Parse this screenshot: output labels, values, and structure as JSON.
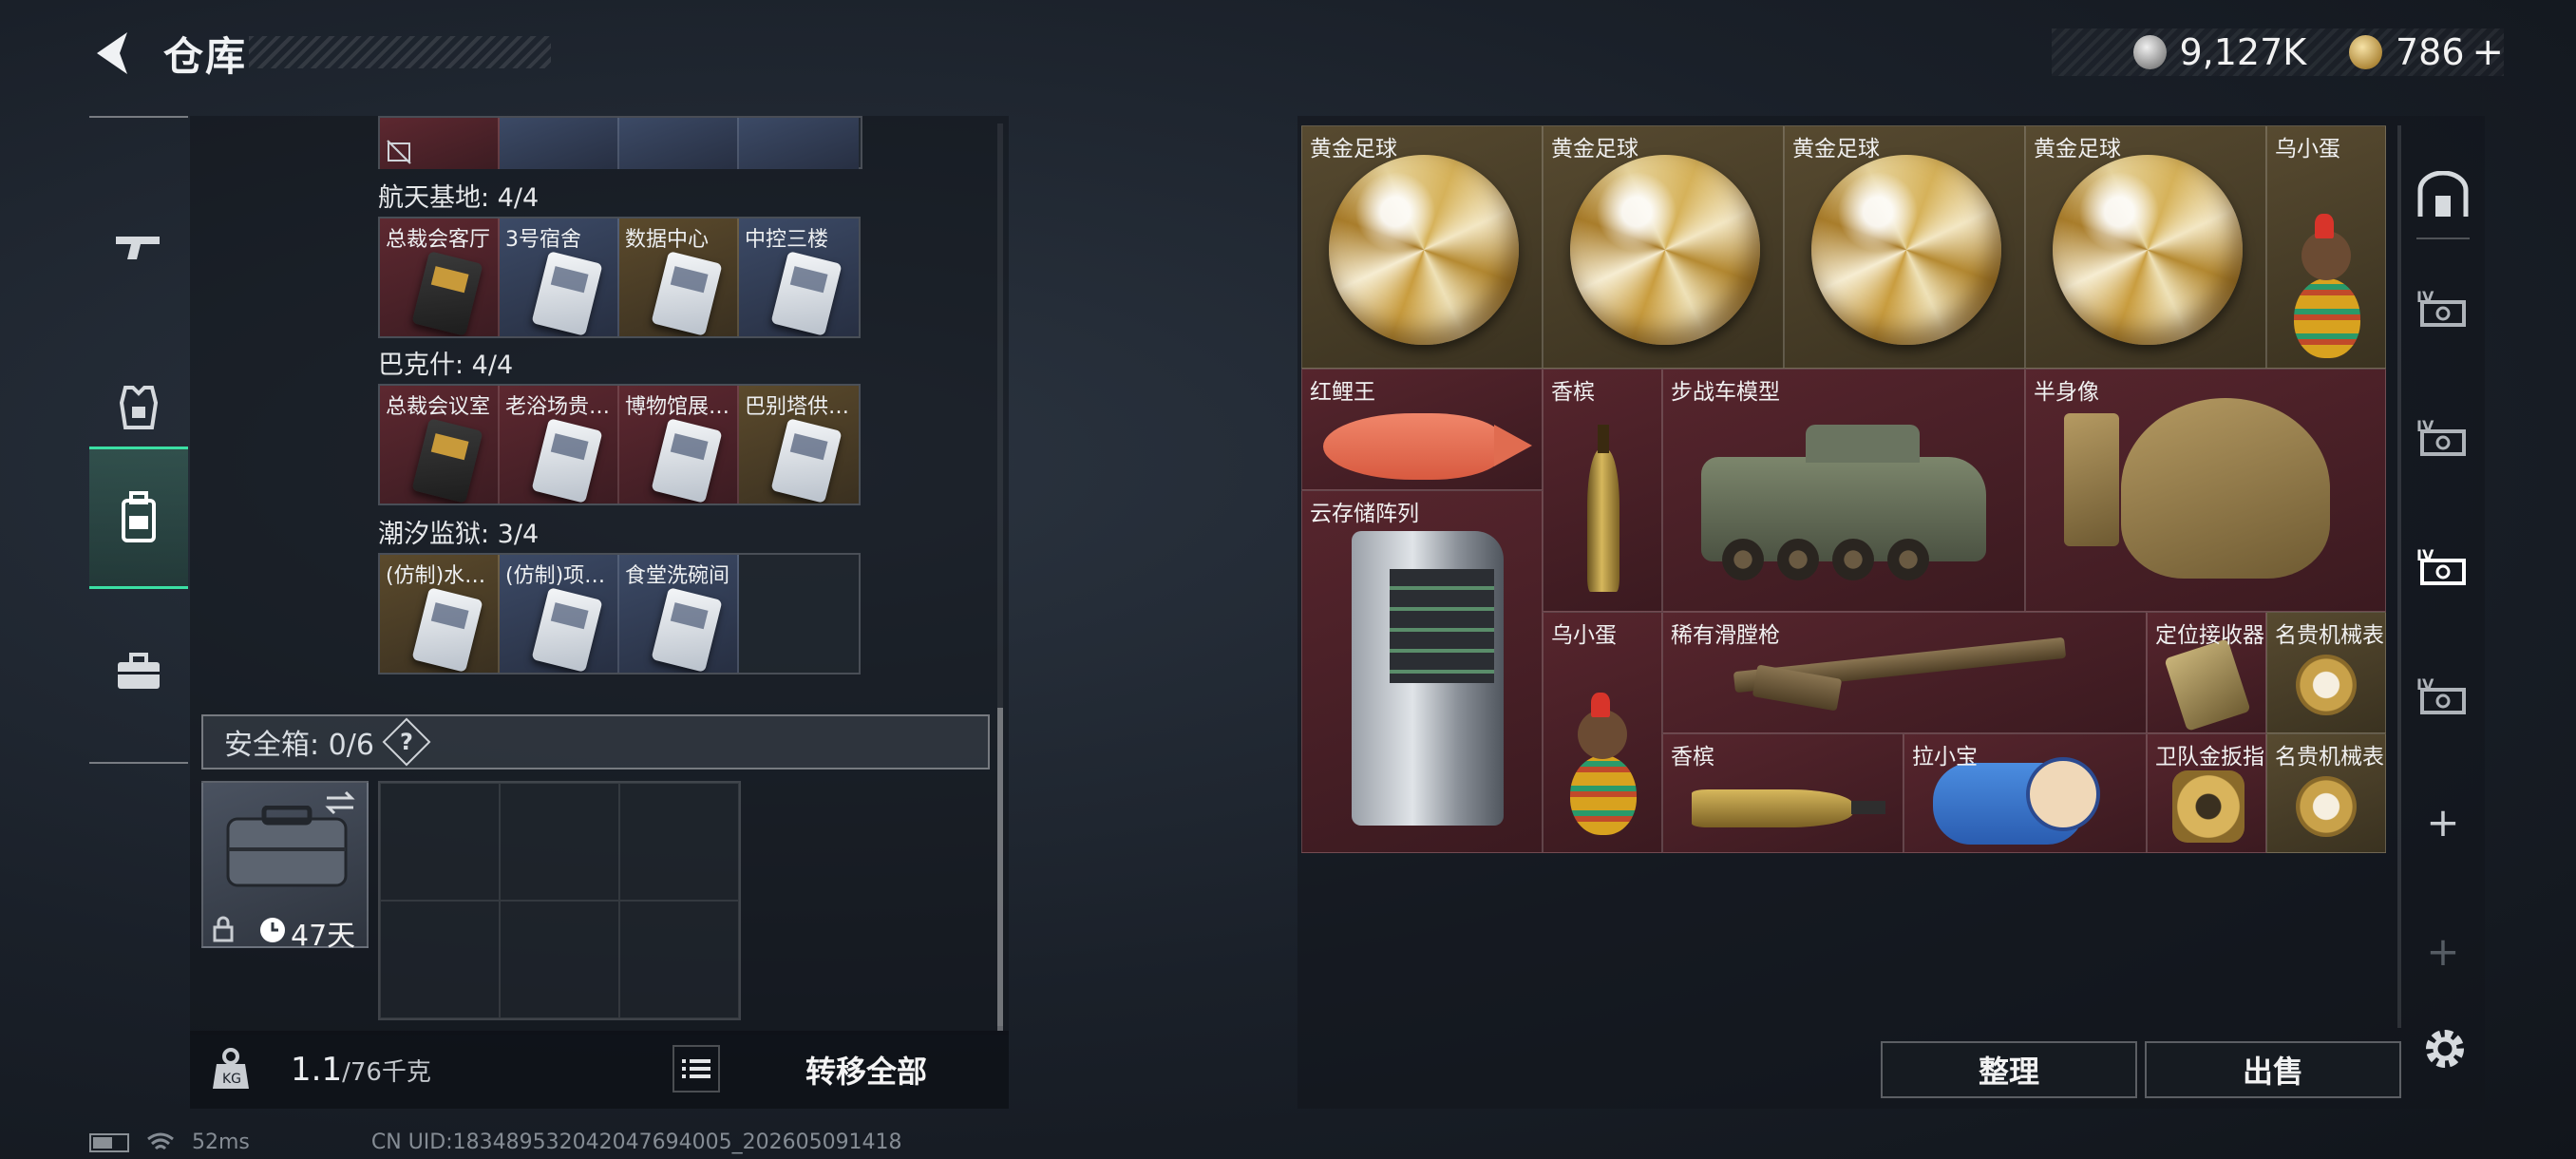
{
  "header": {
    "title": "仓库",
    "currency": [
      {
        "icon": "silver-coin-icon",
        "value": "9,127K"
      },
      {
        "icon": "gold-coin-icon",
        "value": "786",
        "suffix": "+"
      }
    ]
  },
  "left_nav": {
    "items": [
      {
        "icon": "gun-icon",
        "active": false
      },
      {
        "icon": "armor-icon",
        "active": false
      },
      {
        "icon": "backpack-icon",
        "active": true
      },
      {
        "icon": "briefcase-icon",
        "active": false
      }
    ]
  },
  "keycard_groups": [
    {
      "label": "航天基地: 4/4",
      "cards": [
        {
          "name": "总裁会客厅",
          "color": "red"
        },
        {
          "name": "3号宿舍",
          "color": "blue"
        },
        {
          "name": "数据中心",
          "color": "gold"
        },
        {
          "name": "中控三楼",
          "color": "blue"
        }
      ]
    },
    {
      "label": "巴克什: 4/4",
      "cards": [
        {
          "name": "总裁会议室",
          "color": "red"
        },
        {
          "name": "老浴场贵…",
          "color": "red"
        },
        {
          "name": "博物馆展…",
          "color": "red"
        },
        {
          "name": "巴别塔供…",
          "color": "gold"
        }
      ]
    },
    {
      "label": "潮汐监狱: 3/4",
      "cards": [
        {
          "name": "(仿制)水…",
          "color": "gold"
        },
        {
          "name": "(仿制)项…",
          "color": "blue"
        },
        {
          "name": "食堂洗碗间",
          "color": "blue"
        },
        {
          "name": "",
          "color": "empty"
        }
      ]
    }
  ],
  "safe_box": {
    "label": "安全箱: 0/6",
    "help": "?",
    "duration": "47天"
  },
  "weight": {
    "current": "1.1",
    "max": "/76千克"
  },
  "buttons": {
    "transfer_all": "转移全部",
    "sort": "整理",
    "sell": "出售"
  },
  "status": {
    "ping": "52ms",
    "uid": "CN UID:18348953204204769​4005_202605091418"
  },
  "stash_items": [
    {
      "name": "黄金足球"
    },
    {
      "name": "黄金足球"
    },
    {
      "name": "黄金足球"
    },
    {
      "name": "黄金足球"
    },
    {
      "name": "乌小蛋"
    },
    {
      "name": "红鲤王"
    },
    {
      "name": "香槟"
    },
    {
      "name": "步战车模型"
    },
    {
      "name": "半身像"
    },
    {
      "name": "云存储阵列"
    },
    {
      "name": "乌小蛋"
    },
    {
      "name": "稀有滑膛枪"
    },
    {
      "name": "定位接收器"
    },
    {
      "name": "名贵机械表"
    },
    {
      "name": "香槟"
    },
    {
      "name": "拉小宝"
    },
    {
      "name": "卫队金扳指"
    },
    {
      "name": "名贵机械表"
    }
  ],
  "right_nav": {
    "items": [
      {
        "icon": "storage-main-icon"
      },
      {
        "icon": "storage-tab-icon",
        "label": "IV"
      },
      {
        "icon": "storage-tab-icon",
        "label": "IV"
      },
      {
        "icon": "storage-tab-icon",
        "label": "IV",
        "active": true
      },
      {
        "icon": "storage-tab-icon",
        "label": "IV"
      },
      {
        "icon": "add-icon",
        "label": "+"
      },
      {
        "icon": "add-icon",
        "label": "+"
      }
    ]
  }
}
